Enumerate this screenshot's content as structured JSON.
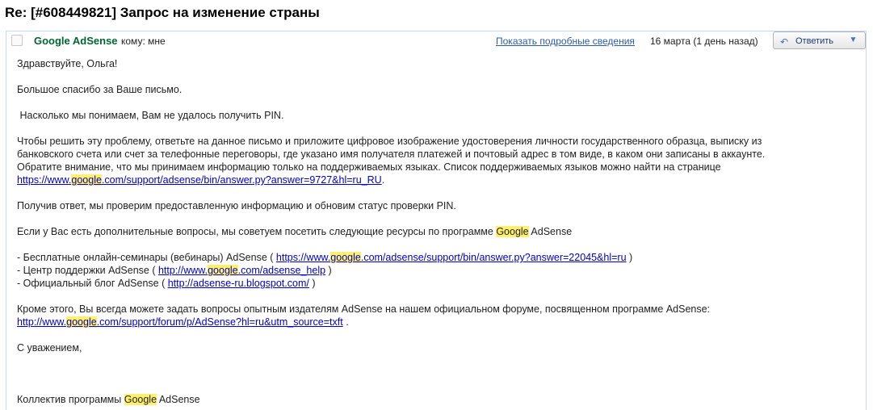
{
  "subject": "Re: [#608449821] Запрос на изменение страны",
  "header": {
    "sender": "Google AdSense",
    "to_label": "кому: мне",
    "details_link": "Показать подробные сведения",
    "date": "16 марта (1 день назад)",
    "reply_label": "Ответить",
    "more_icon": "chevron-down-icon"
  },
  "body": {
    "greeting": "Здравствуйте, Ольга!",
    "thanks": "Большое спасибо за Ваше письмо.",
    "understand": " Насколько мы понимаем, Вам не удалось получить PIN.",
    "solve_1": "Чтобы решить эту проблему, ответьте на данное письмо и приложите цифровое изображение удостоверения личности государственного образца, выписку из",
    "solve_2": "банковского счета или счет за телефонные переговоры, где указано имя получателя платежей и почтовый адрес в том виде, в каком они записаны в аккаунте.",
    "solve_3": "Обратите внимание, что мы принимаем информацию только на поддерживаемых языках. Список поддерживаемых языков можно найти на странице",
    "lang_link_a": "https://www.",
    "lang_link_hl": "google",
    "lang_link_b": ".com/support/adsense/bin/answer.py?answer=9727&hl=ru_RU",
    "lang_link_tail": ".",
    "verify": "Получив ответ, мы проверим предоставленную информацию и обновим статус проверки PIN.",
    "resources_a": "Если у Вас есть дополнительные вопросы, мы советуем посетить следующие ресурсы по программе ",
    "resources_hl": "Google",
    "resources_b": " AdSense",
    "res1_text": "- Бесплатные онлайн-семинары (вебинары) AdSense ( ",
    "res1_link_a": "https://www.",
    "res1_link_hl": "google",
    "res1_link_b": ".com/adsense/support/bin/answer.py?answer=22045&hl=ru",
    "res1_tail": " )",
    "res2_text": "- Центр поддержки AdSense ( ",
    "res2_link_a": "http://www.",
    "res2_link_hl": "google",
    "res2_link_b": ".com/adsense_help",
    "res2_tail": " )",
    "res3_text": "- Официальный блог AdSense ( ",
    "res3_link": "http://adsense-ru.blogspot.com/",
    "res3_tail": " )",
    "forum_1": "Кроме этого, Вы всегда можете задать вопросы опытным издателям AdSense на нашем официальном форуме, посвященном программе AdSense:",
    "forum_link_a": "http://www.",
    "forum_link_hl": "google",
    "forum_link_b": ".com/support/forum/p/AdSense?hl=ru&utm_source=txft",
    "forum_tail": " .",
    "regards": "С уважением,",
    "team_a": "Коллектив программы ",
    "team_hl": "Google",
    "team_b": " AdSense"
  },
  "colors": {
    "sender": "#006633",
    "link": "#0000cc",
    "highlight": "#fff16b",
    "border": "#c3d9ff"
  }
}
